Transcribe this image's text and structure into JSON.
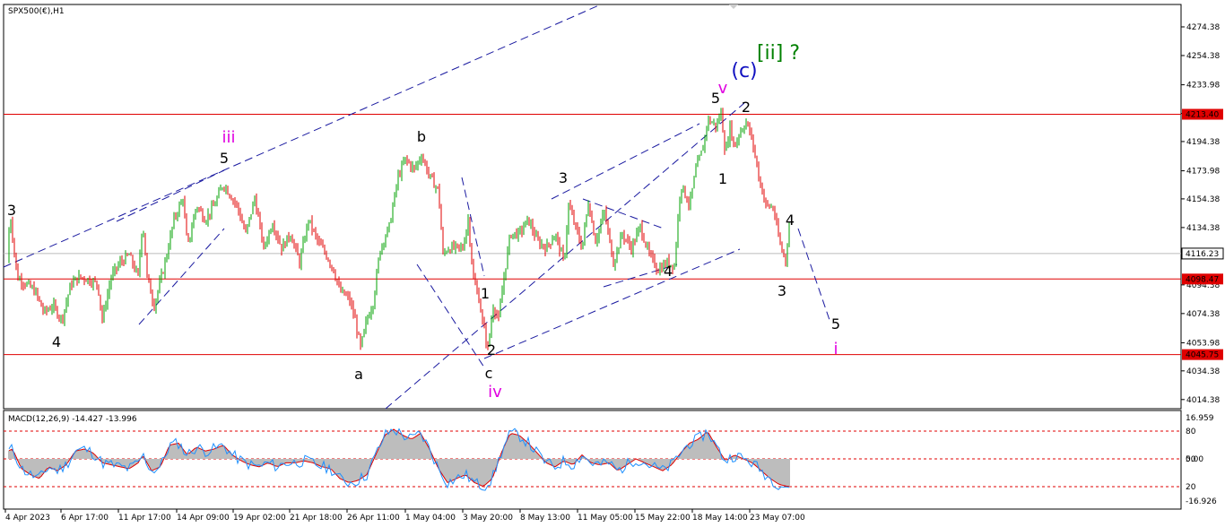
{
  "chart_data": [
    {
      "type": "candlestick",
      "title": "SPX500(€),H1",
      "ylim": [
        4008,
        4290
      ],
      "y_ticks": [
        "4274.38",
        "4254.38",
        "4233.98",
        "4213.98",
        "4194.38",
        "4173.98",
        "4154.38",
        "4134.38",
        "4114.38",
        "4094.38",
        "4074.38",
        "4053.98",
        "4034.38",
        "4014.38"
      ],
      "x_labels": [
        "4 Apr 2023",
        "6 Apr 17:00",
        "11 Apr 17:00",
        "14 Apr 09:00",
        "19 Apr 02:00",
        "21 Apr 18:00",
        "26 Apr 11:00",
        "1 May 04:00",
        "3 May 20:00",
        "8 May 13:00",
        "11 May 05:00",
        "15 May 22:00",
        "18 May 14:00",
        "23 May 07:00"
      ],
      "colors": {
        "up": "#00a000",
        "down": "#e00000",
        "wick": "#222222",
        "level": "#e00000",
        "channel": "#1a1aa0",
        "current": "#bbbbbb"
      },
      "horizontal_levels": [
        {
          "label": "4213.40",
          "value": 4213.4
        },
        {
          "label": "4098.47",
          "value": 4098.47
        },
        {
          "label": "4045.75",
          "value": 4045.75
        }
      ],
      "current_price": {
        "label": "4116.23",
        "value": 4116.23
      },
      "price_path": [
        [
          0,
          4110
        ],
        [
          8,
          4140
        ],
        [
          15,
          4100
        ],
        [
          25,
          4095
        ],
        [
          35,
          4090
        ],
        [
          45,
          4075
        ],
        [
          55,
          4080
        ],
        [
          65,
          4070
        ],
        [
          75,
          4095
        ],
        [
          85,
          4100
        ],
        [
          95,
          4098
        ],
        [
          105,
          4095
        ],
        [
          110,
          4070
        ],
        [
          120,
          4100
        ],
        [
          130,
          4110
        ],
        [
          140,
          4115
        ],
        [
          150,
          4100
        ],
        [
          155,
          4140
        ],
        [
          160,
          4100
        ],
        [
          168,
          4080
        ],
        [
          180,
          4110
        ],
        [
          190,
          4140
        ],
        [
          200,
          4155
        ],
        [
          205,
          4120
        ],
        [
          215,
          4150
        ],
        [
          225,
          4140
        ],
        [
          235,
          4150
        ],
        [
          245,
          4165
        ],
        [
          250,
          4160
        ],
        [
          260,
          4150
        ],
        [
          270,
          4130
        ],
        [
          280,
          4155
        ],
        [
          290,
          4120
        ],
        [
          300,
          4138
        ],
        [
          310,
          4120
        ],
        [
          320,
          4130
        ],
        [
          330,
          4110
        ],
        [
          340,
          4140
        ],
        [
          350,
          4125
        ],
        [
          360,
          4115
        ],
        [
          368,
          4105
        ],
        [
          375,
          4090
        ],
        [
          385,
          4085
        ],
        [
          392,
          4070
        ],
        [
          398,
          4050
        ],
        [
          405,
          4070
        ],
        [
          412,
          4082
        ],
        [
          420,
          4120
        ],
        [
          430,
          4135
        ],
        [
          440,
          4170
        ],
        [
          448,
          4182
        ],
        [
          458,
          4175
        ],
        [
          466,
          4185
        ],
        [
          475,
          4170
        ],
        [
          485,
          4160
        ],
        [
          490,
          4115
        ],
        [
          495,
          4120
        ],
        [
          505,
          4120
        ],
        [
          512,
          4120
        ],
        [
          518,
          4140
        ],
        [
          524,
          4098
        ],
        [
          530,
          4085
        ],
        [
          535,
          4065
        ],
        [
          540,
          4050
        ],
        [
          546,
          4080
        ],
        [
          552,
          4070
        ],
        [
          558,
          4100
        ],
        [
          565,
          4130
        ],
        [
          575,
          4130
        ],
        [
          585,
          4140
        ],
        [
          595,
          4125
        ],
        [
          605,
          4120
        ],
        [
          615,
          4130
        ],
        [
          625,
          4110
        ],
        [
          630,
          4150
        ],
        [
          635,
          4140
        ],
        [
          645,
          4120
        ],
        [
          652,
          4152
        ],
        [
          660,
          4125
        ],
        [
          670,
          4145
        ],
        [
          680,
          4110
        ],
        [
          690,
          4130
        ],
        [
          700,
          4120
        ],
        [
          710,
          4135
        ],
        [
          720,
          4115
        ],
        [
          730,
          4105
        ],
        [
          740,
          4110
        ],
        [
          748,
          4108
        ],
        [
          755,
          4165
        ],
        [
          765,
          4150
        ],
        [
          772,
          4175
        ],
        [
          780,
          4190
        ],
        [
          785,
          4210
        ],
        [
          795,
          4205
        ],
        [
          800,
          4215
        ],
        [
          805,
          4185
        ],
        [
          810,
          4205
        ],
        [
          815,
          4190
        ],
        [
          820,
          4200
        ],
        [
          828,
          4208
        ],
        [
          835,
          4195
        ],
        [
          842,
          4170
        ],
        [
          850,
          4150
        ],
        [
          858,
          4148
        ],
        [
          866,
          4122
        ],
        [
          872,
          4112
        ],
        [
          876,
          4135
        ]
      ]
    },
    {
      "type": "line",
      "title": "MACD(12,26,9) -14.427 -13.996",
      "y_ticks_right": [
        "16.959",
        "0.00",
        "-16.926"
      ],
      "y_ticks_left": [
        "80",
        "20"
      ],
      "y_ticks_mid": [
        "50"
      ],
      "note_series": [
        "MACD histogram",
        "signal"
      ],
      "values": [
        [
          0,
          3
        ],
        [
          10,
          5
        ],
        [
          20,
          -5
        ],
        [
          30,
          -8
        ],
        [
          40,
          -10
        ],
        [
          50,
          -4
        ],
        [
          60,
          -6
        ],
        [
          70,
          -3
        ],
        [
          80,
          4
        ],
        [
          90,
          5
        ],
        [
          100,
          3
        ],
        [
          110,
          -2
        ],
        [
          120,
          -3
        ],
        [
          130,
          -4
        ],
        [
          140,
          -5
        ],
        [
          150,
          -2
        ],
        [
          155,
          2
        ],
        [
          165,
          -6
        ],
        [
          175,
          -4
        ],
        [
          185,
          7
        ],
        [
          195,
          8
        ],
        [
          205,
          2
        ],
        [
          215,
          6
        ],
        [
          225,
          4
        ],
        [
          235,
          5
        ],
        [
          245,
          7
        ],
        [
          255,
          2
        ],
        [
          265,
          -1
        ],
        [
          275,
          -3
        ],
        [
          285,
          -4
        ],
        [
          295,
          -2
        ],
        [
          305,
          -4
        ],
        [
          315,
          -2
        ],
        [
          325,
          -2
        ],
        [
          335,
          -1
        ],
        [
          345,
          -2
        ],
        [
          355,
          -4
        ],
        [
          365,
          -5
        ],
        [
          375,
          -10
        ],
        [
          385,
          -12
        ],
        [
          395,
          -11
        ],
        [
          405,
          -8
        ],
        [
          415,
          2
        ],
        [
          425,
          12
        ],
        [
          435,
          15
        ],
        [
          445,
          12
        ],
        [
          455,
          10
        ],
        [
          465,
          13
        ],
        [
          475,
          5
        ],
        [
          485,
          -5
        ],
        [
          495,
          -12
        ],
        [
          505,
          -10
        ],
        [
          515,
          -8
        ],
        [
          525,
          -12
        ],
        [
          535,
          -14
        ],
        [
          545,
          -10
        ],
        [
          555,
          3
        ],
        [
          565,
          13
        ],
        [
          575,
          12
        ],
        [
          585,
          8
        ],
        [
          595,
          3
        ],
        [
          605,
          -2
        ],
        [
          615,
          -4
        ],
        [
          625,
          -1
        ],
        [
          635,
          -3
        ],
        [
          645,
          2
        ],
        [
          655,
          -2
        ],
        [
          665,
          -3
        ],
        [
          675,
          -2
        ],
        [
          685,
          -6
        ],
        [
          695,
          -3
        ],
        [
          705,
          0
        ],
        [
          715,
          -2
        ],
        [
          725,
          -4
        ],
        [
          735,
          -6
        ],
        [
          745,
          -3
        ],
        [
          755,
          3
        ],
        [
          765,
          8
        ],
        [
          775,
          10
        ],
        [
          785,
          14
        ],
        [
          795,
          6
        ],
        [
          805,
          -1
        ],
        [
          815,
          2
        ],
        [
          825,
          0
        ],
        [
          835,
          -2
        ],
        [
          845,
          -6
        ],
        [
          855,
          -10
        ],
        [
          865,
          -13
        ],
        [
          875,
          -14
        ]
      ]
    }
  ],
  "wave_labels": [
    {
      "text": "3",
      "c": "#000000"
    },
    {
      "text": "4",
      "c": "#000000"
    },
    {
      "text": "5",
      "c": "#000000"
    },
    {
      "text": "iii",
      "c": "#e000e0"
    },
    {
      "text": "a",
      "c": "#000000"
    },
    {
      "text": "b",
      "c": "#000000"
    },
    {
      "text": "1",
      "c": "#000000"
    },
    {
      "text": "2",
      "c": "#000000"
    },
    {
      "text": "c",
      "c": "#000000"
    },
    {
      "text": "iv",
      "c": "#e000e0"
    },
    {
      "text": "3",
      "c": "#000000"
    },
    {
      "text": "4",
      "c": "#000000"
    },
    {
      "text": "5",
      "c": "#000000"
    },
    {
      "text": "v",
      "c": "#e000e0"
    },
    {
      "text": "(c)",
      "c": "#1010c0"
    },
    {
      "text": "[ii] ?",
      "c": "#008000"
    },
    {
      "text": "2",
      "c": "#000000"
    },
    {
      "text": "1",
      "c": "#000000"
    },
    {
      "text": "4",
      "c": "#000000"
    },
    {
      "text": "3",
      "c": "#000000"
    },
    {
      "text": "5",
      "c": "#000000"
    },
    {
      "text": "i",
      "c": "#e000e0"
    }
  ]
}
